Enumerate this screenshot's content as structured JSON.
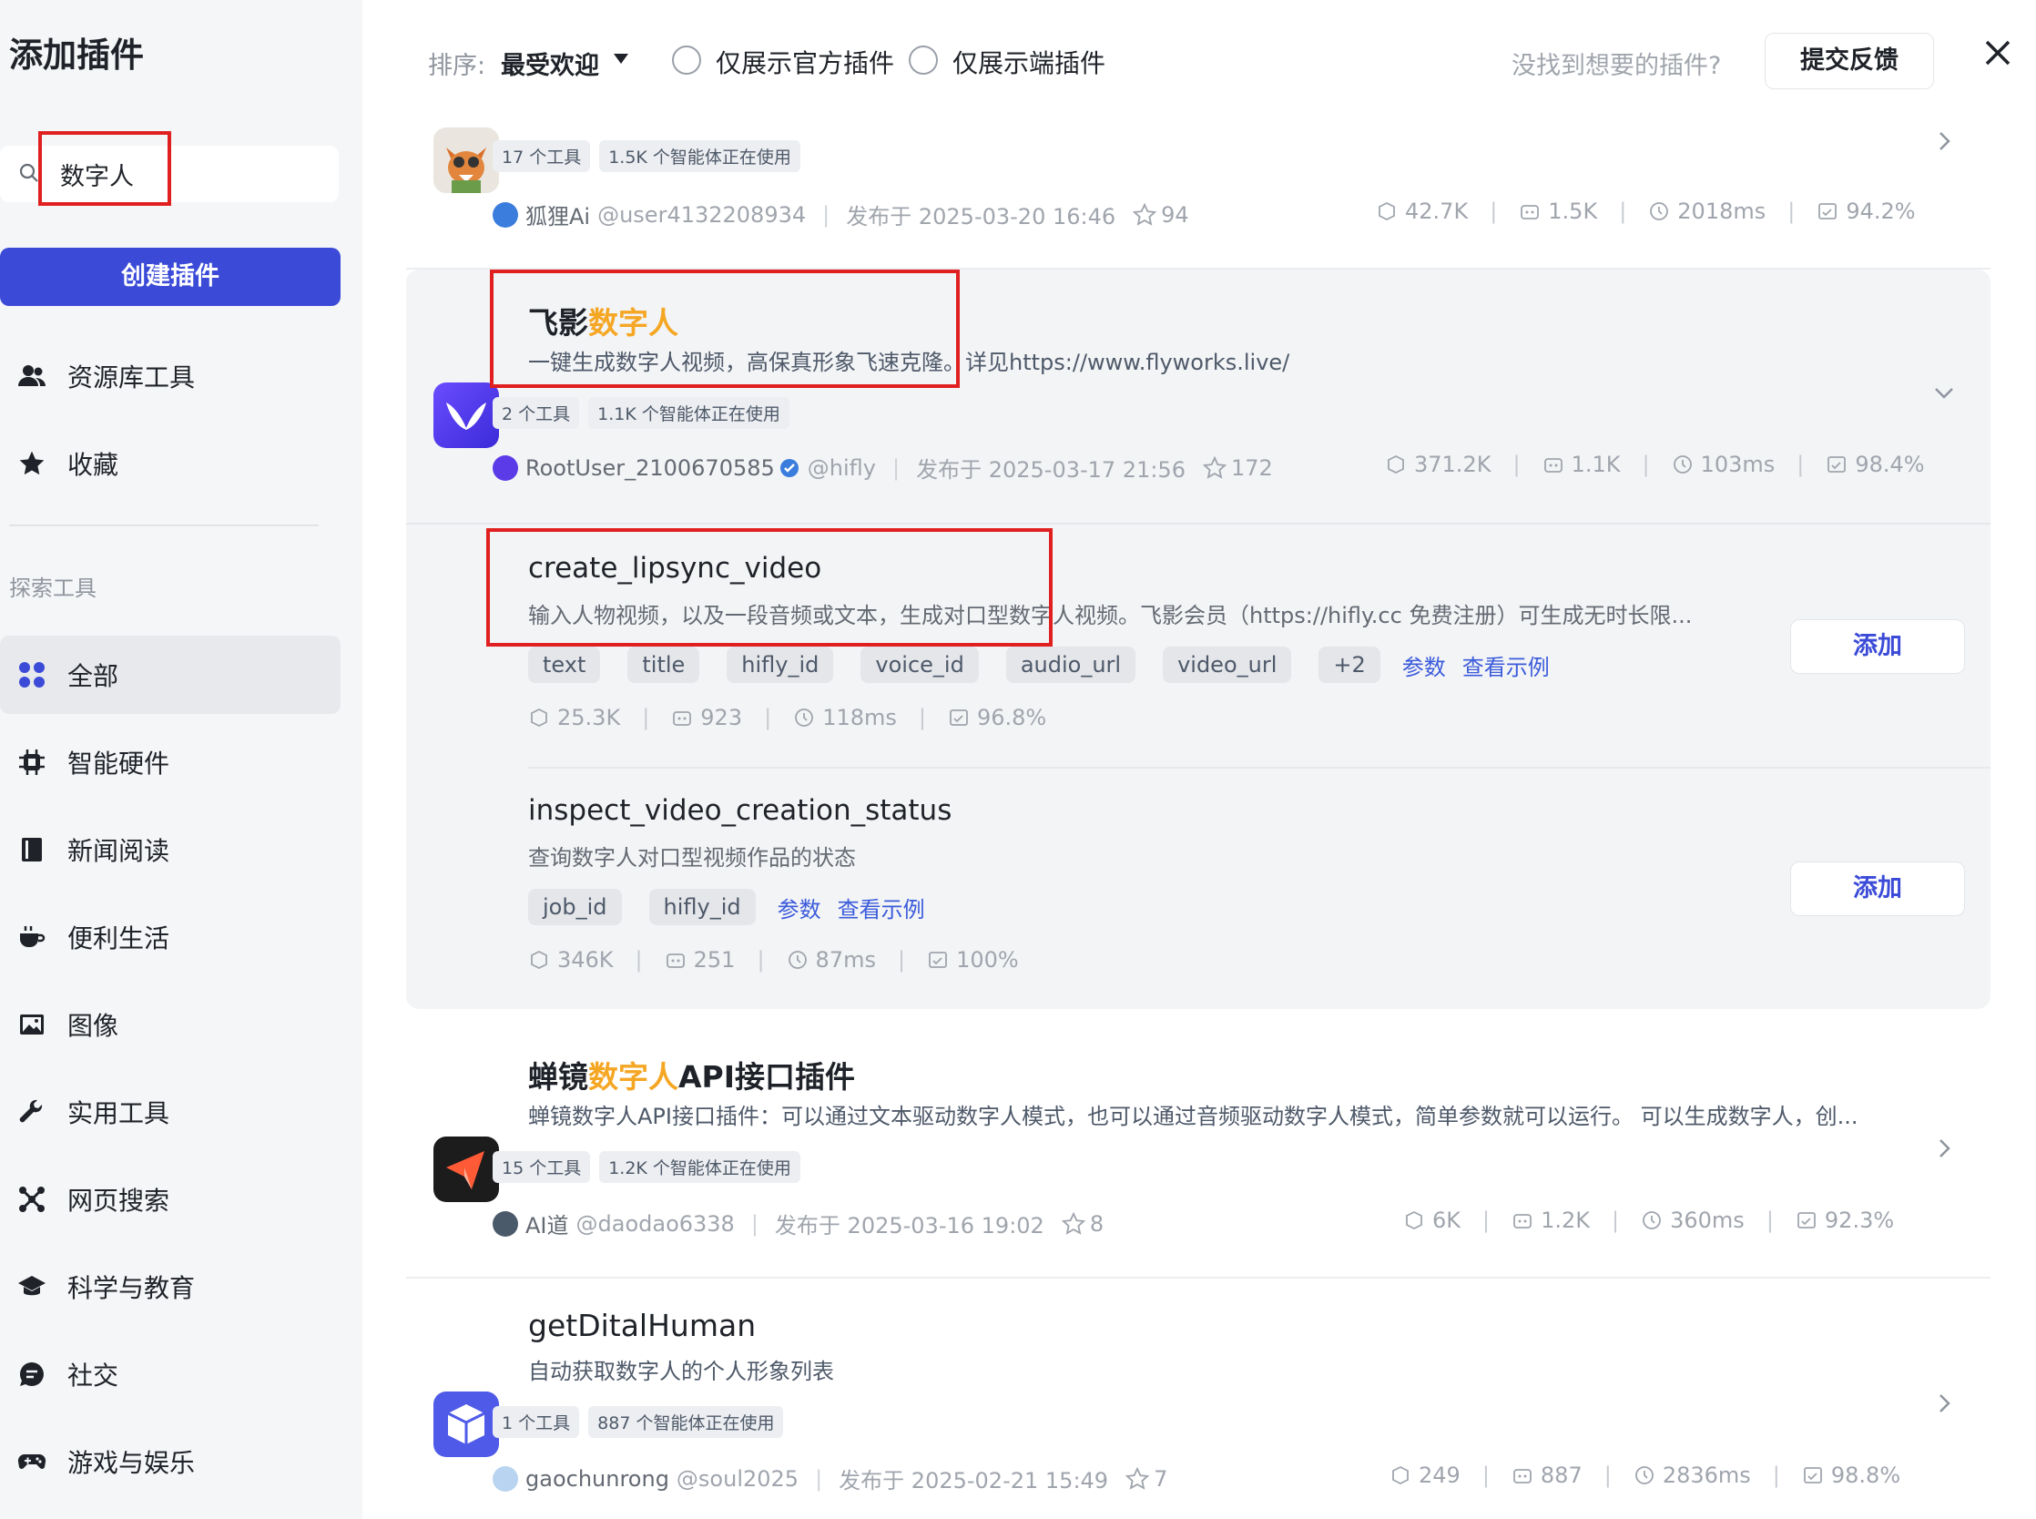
{
  "sidebar": {
    "title": "添加插件",
    "search_value": "数字人",
    "create_button": "创建插件",
    "top_items": [
      {
        "label": "资源库工具",
        "icon": "users-icon"
      },
      {
        "label": "收藏",
        "icon": "star-icon"
      }
    ],
    "section_title": "探索工具",
    "categories": [
      {
        "label": "全部",
        "icon": "grid-icon",
        "active": true
      },
      {
        "label": "智能硬件",
        "icon": "chip-icon"
      },
      {
        "label": "新闻阅读",
        "icon": "book-icon"
      },
      {
        "label": "便利生活",
        "icon": "cup-icon"
      },
      {
        "label": "图像",
        "icon": "image-icon"
      },
      {
        "label": "实用工具",
        "icon": "wrench-icon"
      },
      {
        "label": "网页搜索",
        "icon": "network-icon"
      },
      {
        "label": "科学与教育",
        "icon": "graduation-cap-icon"
      },
      {
        "label": "社交",
        "icon": "chat-bubble-icon"
      },
      {
        "label": "游戏与娱乐",
        "icon": "gamepad-icon"
      }
    ]
  },
  "topbar": {
    "sort_label": "排序:",
    "sort_value": "最受欢迎",
    "filter_official": "仅展示官方插件",
    "filter_client": "仅展示端插件",
    "hint": "没找到想要的插件?",
    "feedback_button": "提交反馈"
  },
  "plugins": [
    {
      "name": "",
      "tags": [
        "17 个工具",
        "1.5K 个智能体正在使用"
      ],
      "author": "狐狸Ai",
      "handle": "@user4132208934",
      "published": "发布于 2025-03-20 16:46",
      "stars": "94",
      "stats": [
        "42.7K",
        "1.5K",
        "2018ms",
        "94.2%"
      ]
    },
    {
      "name_prefix": "飞影",
      "name_highlight": "数字人",
      "name_suffix": "",
      "description": "一键生成数字人视频，高保真形象飞速克隆。详见https://www.flyworks.live/",
      "tags": [
        "2 个工具",
        "1.1K 个智能体正在使用"
      ],
      "author": "RootUser_2100670585",
      "handle": "@hifly",
      "published": "发布于 2025-03-17 21:56",
      "stars": "172",
      "stats": [
        "371.2K",
        "1.1K",
        "103ms",
        "98.4%"
      ],
      "tools": [
        {
          "name": "create_lipsync_video",
          "description": "输入人物视频，以及一段音频或文本，生成对口型数字人视频。飞影会员（https://hifly.cc 免费注册）可生成无时长限...",
          "params": [
            "text",
            "title",
            "hifly_id",
            "voice_id",
            "audio_url",
            "video_url",
            "+2"
          ],
          "link_params": "参数",
          "link_examples": "查看示例",
          "stats": [
            "25.3K",
            "923",
            "118ms",
            "96.8%"
          ],
          "add_label": "添加"
        },
        {
          "name": "inspect_video_creation_status",
          "description": "查询数字人对口型视频作品的状态",
          "params": [
            "job_id",
            "hifly_id"
          ],
          "link_params": "参数",
          "link_examples": "查看示例",
          "stats": [
            "346K",
            "251",
            "87ms",
            "100%"
          ],
          "add_label": "添加"
        }
      ]
    },
    {
      "name_prefix": "蝉镜",
      "name_highlight": "数字人",
      "name_suffix": "API接口插件",
      "description": "蝉镜数字人API接口插件：可以通过文本驱动数字人模式，也可以通过音频驱动数字人模式，简单参数就可以运行。 可以生成数字人，创...",
      "tags": [
        "15 个工具",
        "1.2K 个智能体正在使用"
      ],
      "author": "AI道",
      "handle": "@daodao6338",
      "published": "发布于 2025-03-16 19:02",
      "stars": "8",
      "stats": [
        "6K",
        "1.2K",
        "360ms",
        "92.3%"
      ]
    },
    {
      "name": "getDitalHuman",
      "description": "自动获取数字人的个人形象列表",
      "tags": [
        "1 个工具",
        "887 个智能体正在使用"
      ],
      "author": "gaochunrong",
      "handle": "@soul2025",
      "published": "发布于 2025-02-21 15:49",
      "stars": "7",
      "stats": [
        "249",
        "887",
        "2836ms",
        "98.8%"
      ]
    }
  ],
  "colors": {
    "accent": "#3b4bd8",
    "highlight": "#f5a623",
    "annotation_box": "#e02020"
  }
}
